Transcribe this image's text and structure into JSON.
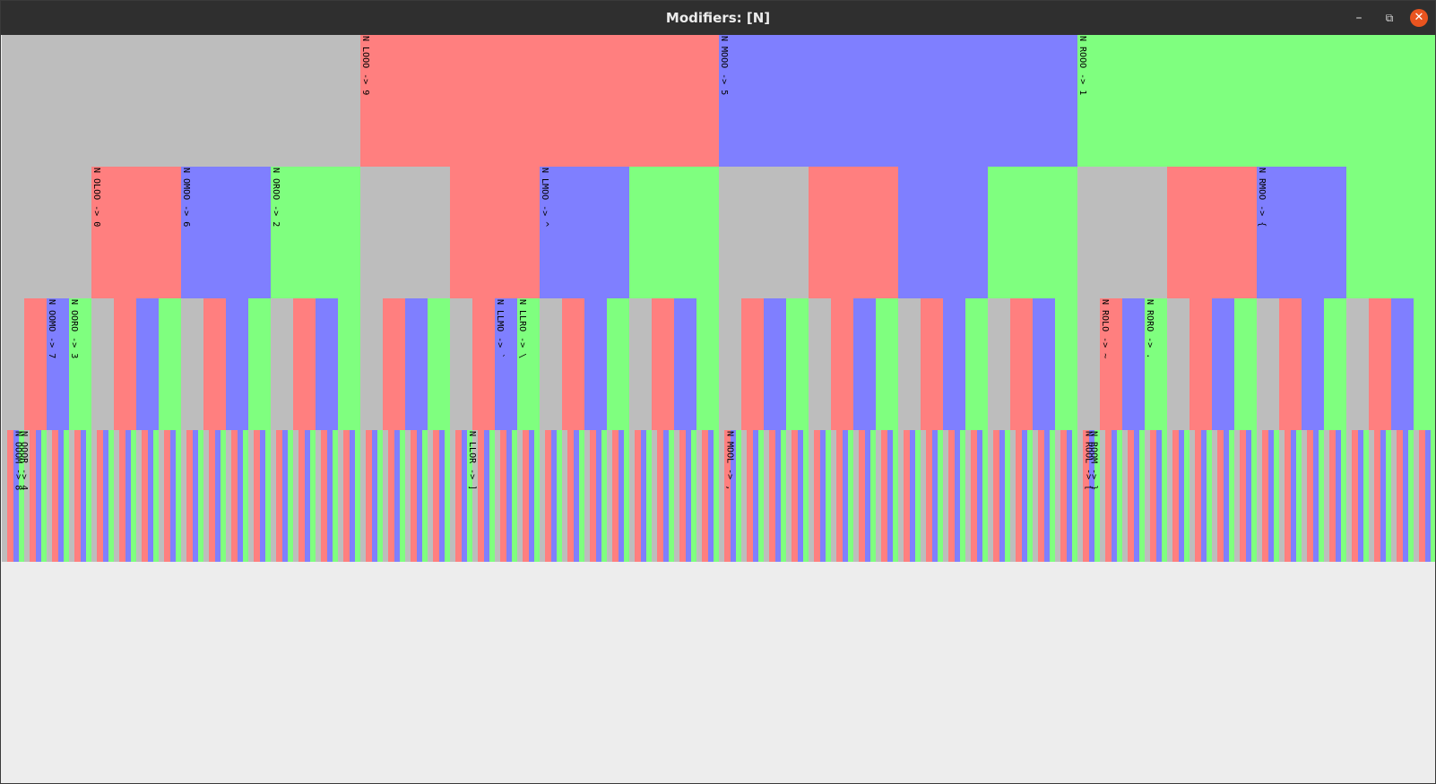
{
  "window": {
    "title": "Modifiers: [N]",
    "minimize_icon": "minimize-icon",
    "maximize_icon": "restore-icon",
    "close_icon": "close-icon"
  },
  "palette": {
    "gray": "#bdbdbd",
    "red": "#ff7f7f",
    "blue": "#7f7fff",
    "green": "#7fff7f",
    "background": "#ededed",
    "titlebar": "#2f2f2f",
    "close": "#e9541f"
  },
  "tree": {
    "levels": 4,
    "color_order": [
      "gray",
      "red",
      "blue",
      "green"
    ],
    "labels": [
      {
        "path": "L",
        "text": "N LOOO -> 9"
      },
      {
        "path": "M",
        "text": "N MOOO -> 5"
      },
      {
        "path": "R",
        "text": "N ROOO -> 1"
      },
      {
        "path": "OL",
        "text": "N OLOO -> 0"
      },
      {
        "path": "OM",
        "text": "N OMOO -> 6"
      },
      {
        "path": "OR",
        "text": "N OROO -> 2"
      },
      {
        "path": "LM",
        "text": "N LMOO -> ^"
      },
      {
        "path": "RM",
        "text": "N RMOO -> {"
      },
      {
        "path": "OOM",
        "text": "N OOMO -> 7"
      },
      {
        "path": "OOR",
        "text": "N OORO -> 3"
      },
      {
        "path": "LLM",
        "text": "N LLMO -> `"
      },
      {
        "path": "LLR",
        "text": "N LLRO -> \\"
      },
      {
        "path": "ROL",
        "text": "N ROLO -> ~"
      },
      {
        "path": "ROR",
        "text": "N RORO -> ."
      },
      {
        "path": "OOOM",
        "text": "N OOOM -> 8"
      },
      {
        "path": "OOOR",
        "text": "N OOOR -> 4"
      },
      {
        "path": "LLOR",
        "text": "N LLOR -> ]"
      },
      {
        "path": "MOOL",
        "text": "N MOOL -> ,"
      },
      {
        "path": "ROOL",
        "text": "N ROOL -> ["
      },
      {
        "path": "ROOM",
        "text": "N ROOM -> }"
      }
    ]
  }
}
